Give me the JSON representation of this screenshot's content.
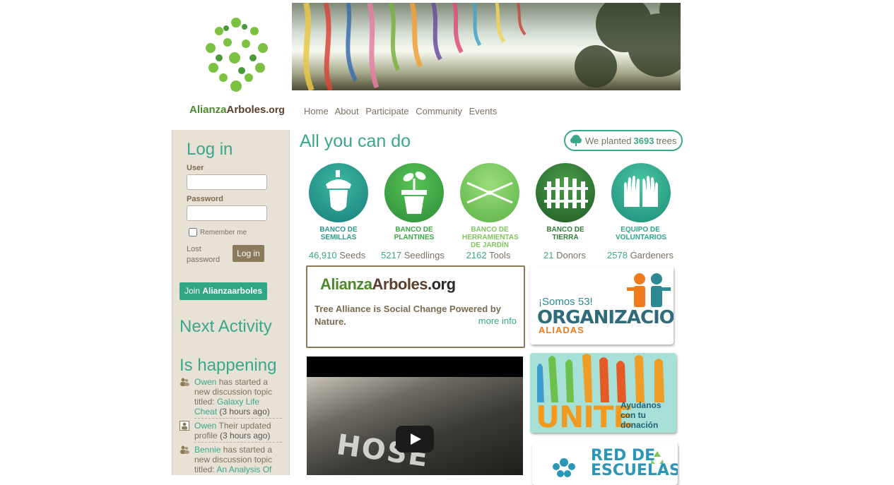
{
  "logo": {
    "word_a": "Alianza",
    "word_b": "Arboles",
    "word_c": ".org"
  },
  "nav": {
    "items": [
      "Home",
      "About",
      "Participate",
      "Community",
      "Events"
    ]
  },
  "login": {
    "title": "Log in",
    "user_label": "User",
    "user_value": "",
    "password_label": "Password",
    "password_value": "",
    "remember_label": "Remember me",
    "lost_password": "Lost password",
    "button": "Log in"
  },
  "join": {
    "prefix": "Join",
    "name": "Alianzaarboles"
  },
  "next_activity": {
    "title": "Next Activity"
  },
  "happening": {
    "title": "Is happening",
    "items": [
      {
        "icon": "group-icon",
        "user": "Owen",
        "action": "has started a new discussion topic titled:",
        "link": "Galaxy Life Cheat",
        "time": "(3 hours ago)"
      },
      {
        "icon": "profile-icon",
        "user": "Owen",
        "action": "Their updated profile",
        "link": "",
        "time": "(3 hours ago)"
      },
      {
        "icon": "group-icon",
        "user": "Bennie",
        "action": "has started a new discussion topic titled:",
        "link": "An Analysis Of",
        "time": ""
      }
    ]
  },
  "main": {
    "title": "All you can do"
  },
  "planted": {
    "prefix": "We planted",
    "count": "3693",
    "suffix": "trees"
  },
  "banks": [
    {
      "label": "BANCO DE SEMILLAS",
      "number": "46,910",
      "unit": "Seeds",
      "color": "#1f8f86",
      "label_color": "#2a9a8b",
      "icon": "acorn-icon"
    },
    {
      "label": "BANCO DE PLANTINES",
      "number": "5217",
      "unit": "Seedlings",
      "color": "#3aa843",
      "label_color": "#3aa843",
      "icon": "seedling-pot-icon"
    },
    {
      "label": "BANCO DE HERRAMIENTAS DE JARDÍN",
      "number": "2162",
      "unit": "Tools",
      "color": "#7ec75a",
      "label_color": "#7ec75a",
      "icon": "shears-icon"
    },
    {
      "label": "BANCO DE TIERRA",
      "number": "21",
      "unit": "Donors",
      "color": "#2e7d32",
      "label_color": "#2e7d32",
      "icon": "fence-icon"
    },
    {
      "label": "EQUIPO DE VOLUNTARIOS",
      "number": "2578",
      "unit": "Gardeners",
      "color": "#24a388",
      "label_color": "#2aa58c",
      "icon": "gloves-icon"
    }
  ],
  "about": {
    "logo_a": "Alianza",
    "logo_b": "Arboles",
    "logo_c": ".org",
    "text": "Tree Alliance is Social Change Powered by Nature.",
    "more": "more info"
  },
  "video": {
    "overlay_text": "HOSE"
  },
  "cards": {
    "org": {
      "line1": "¡Somos 53!",
      "line2": "ORGANIZACIONES",
      "line3": "ALIADAS"
    },
    "unite": {
      "big": "UNITE",
      "line1": "Ayudanos",
      "line2": "con tu",
      "line3": "donación"
    },
    "red": {
      "line1": "RED DE",
      "line2": "ESCUELAS"
    }
  },
  "colors": {
    "accent": "#3aa78a",
    "brown": "#8b7b5a",
    "sidebar_bg": "#e8e2d6"
  }
}
